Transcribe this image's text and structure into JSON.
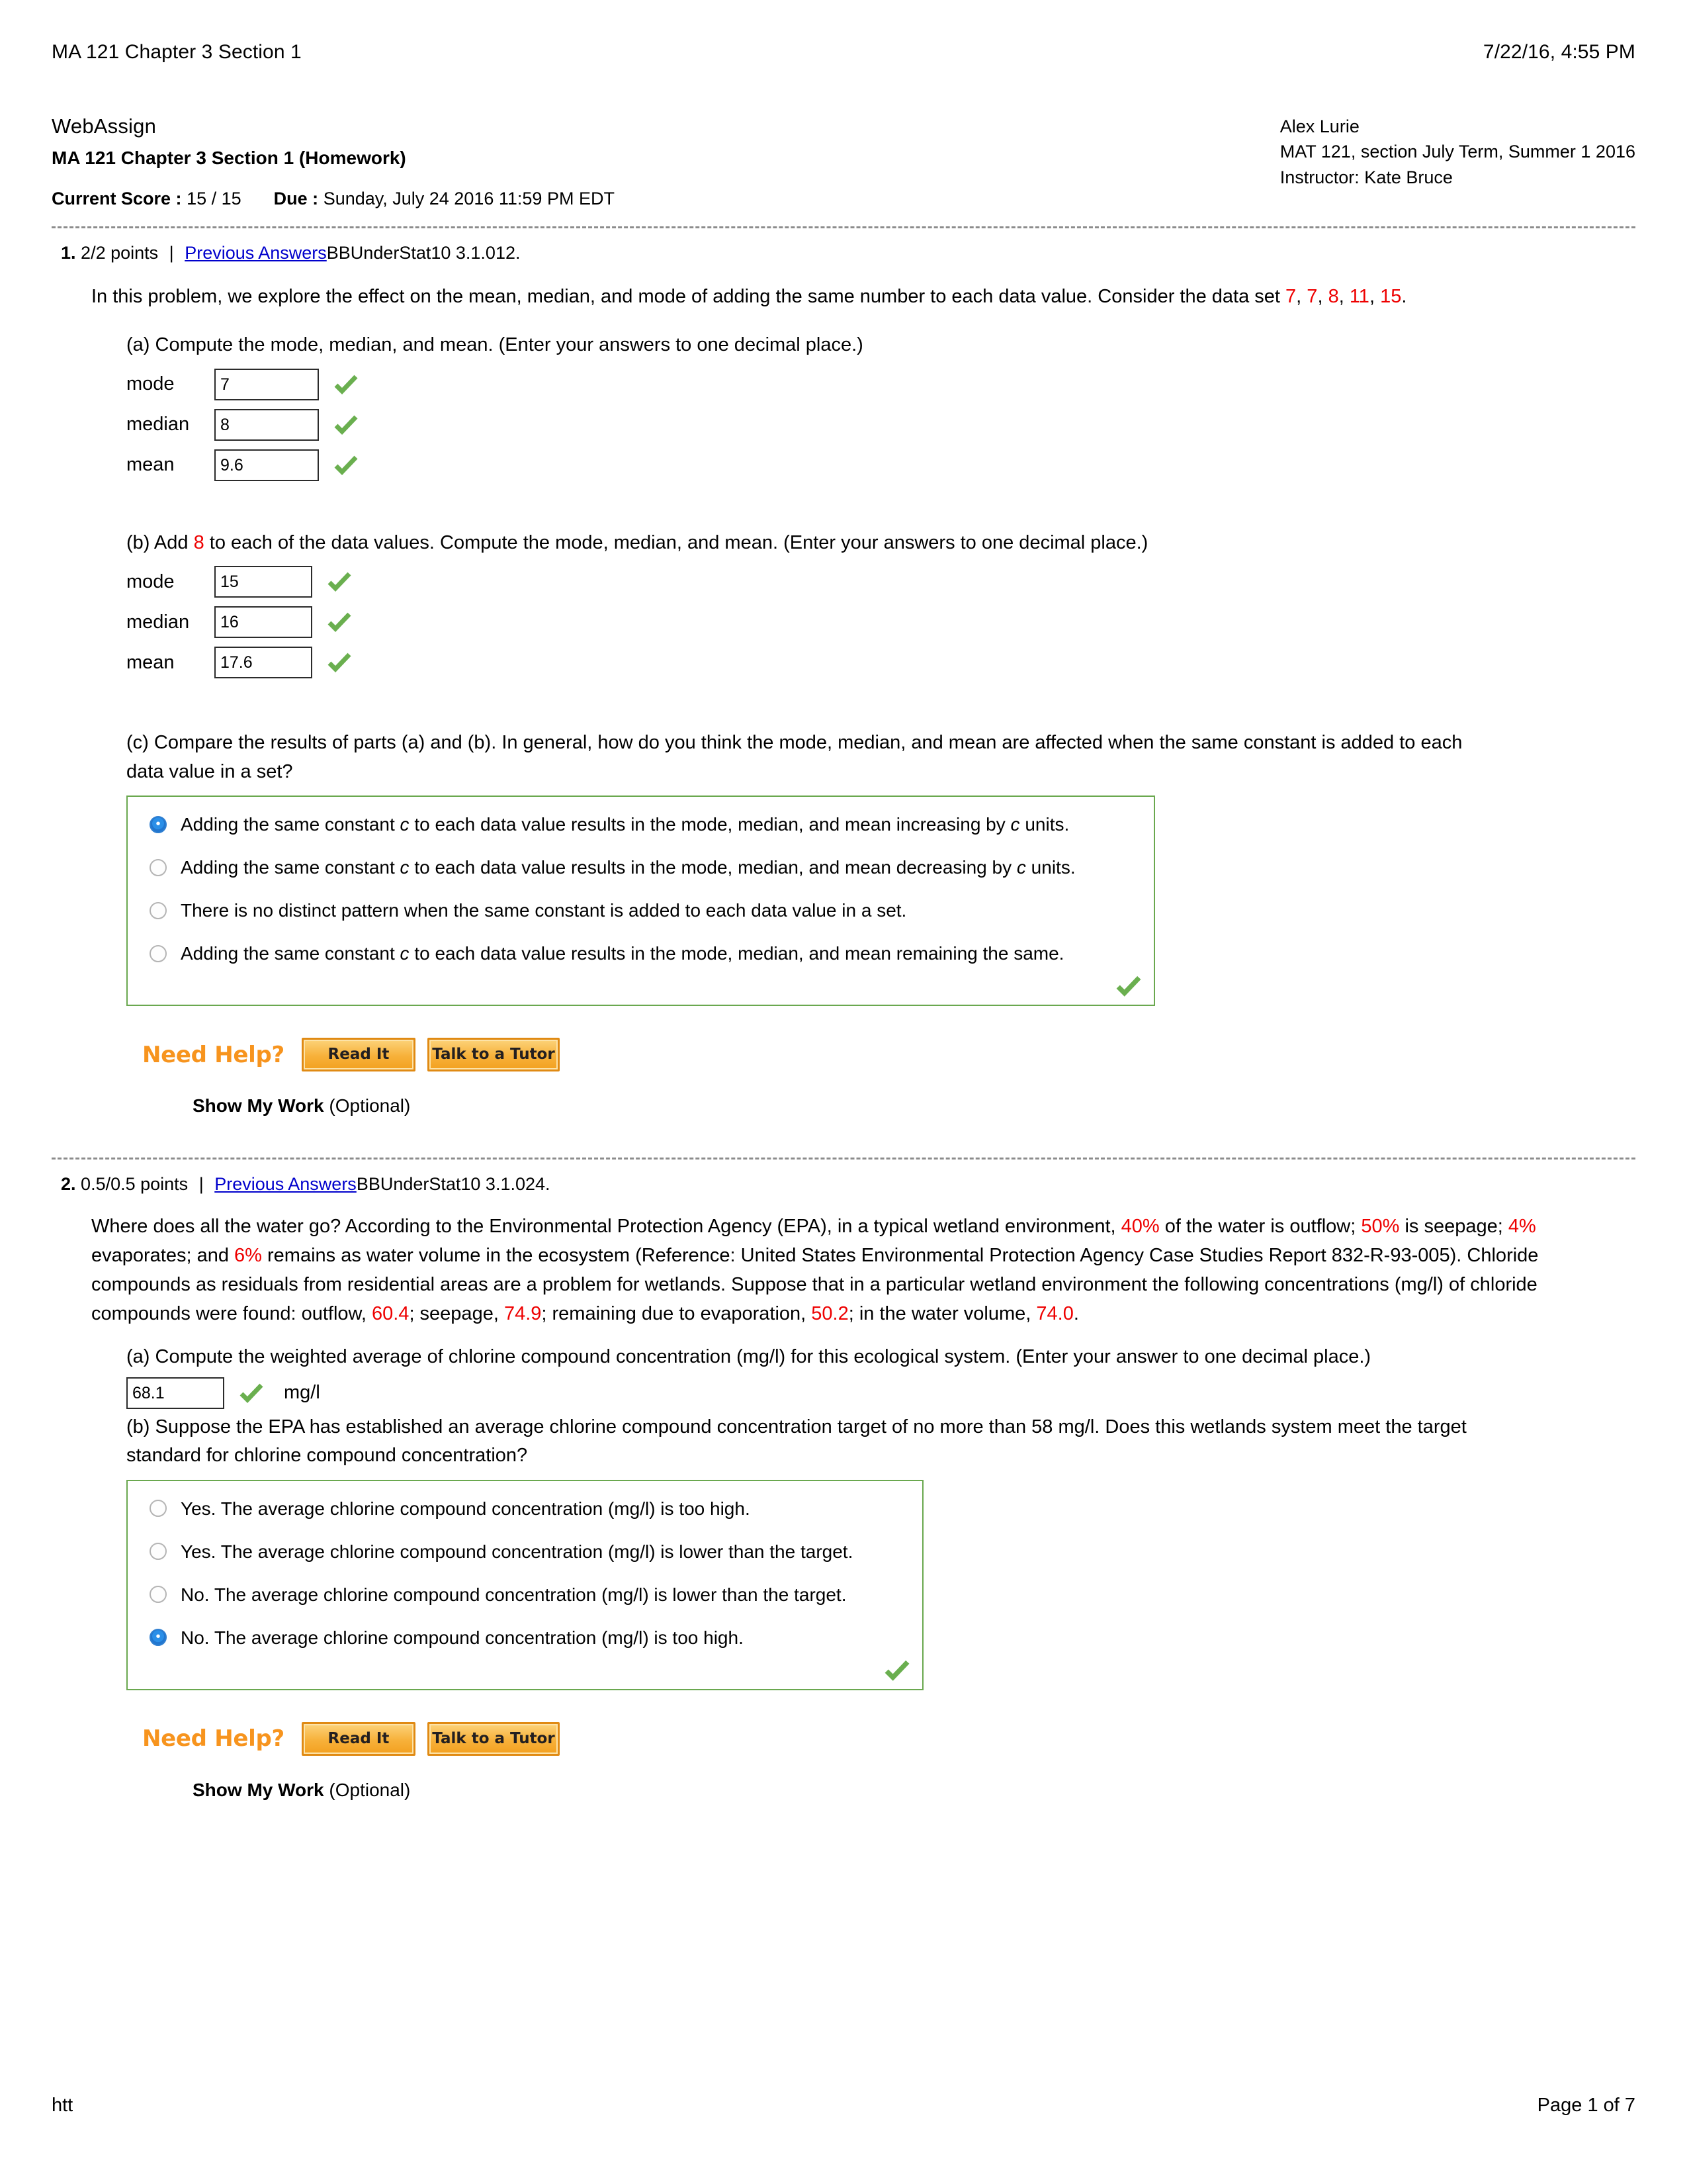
{
  "print_header": {
    "left": "MA 121 Chapter 3 Section 1",
    "right": "7/22/16, 4:55 PM"
  },
  "assignment": {
    "brand": "WebAssign",
    "title": "MA 121 Chapter 3 Section 1 (Homework)",
    "score_label": "Current Score :",
    "score_value": "15 / 15",
    "due_label": "Due :",
    "due_value": "Sunday, July 24 2016 11:59 PM EDT",
    "student": "Alex Lurie",
    "section": "MAT 121, section July Term, Summer 1 2016",
    "instructor": "Instructor: Kate Bruce"
  },
  "questions": [
    {
      "number": "1.",
      "points": "2/2 points",
      "separator": "|",
      "previous_answers": "Previous Answers",
      "code": "BBUnderStat10 3.1.012.",
      "stem_pre": "In this problem, we explore the effect on the mean, median, and mode of adding the same number to each data value. Consider the data set ",
      "data_set": [
        "7",
        "7",
        "8",
        "11",
        "15"
      ],
      "stem_post": ".",
      "part_a": {
        "text": "(a) Compute the mode, median, and mean. (Enter your answers to one decimal place.)",
        "rows": [
          {
            "label": "mode",
            "value": "7",
            "status": "correct"
          },
          {
            "label": "median",
            "value": "8",
            "status": "correct"
          },
          {
            "label": "mean",
            "value": "9.6",
            "status": "correct"
          }
        ]
      },
      "part_b": {
        "text_pre": "(b) Add ",
        "addend": "8",
        "text_post": " to each of the data values. Compute the mode, median, and mean. (Enter your answers to one decimal place.)",
        "rows": [
          {
            "label": "mode",
            "value": "15",
            "status": "correct"
          },
          {
            "label": "median",
            "value": "16",
            "status": "correct"
          },
          {
            "label": "mean",
            "value": "17.6",
            "status": "correct"
          }
        ]
      },
      "part_c": {
        "text_line1": "(c) Compare the results of parts (a) and (b). In general, how do you think the mode, median, and mean are affected when the same constant is added to each",
        "text_line2": "data value in a set?",
        "options": [
          {
            "pre": "Adding the same constant ",
            "var1": "c",
            "mid": " to each data value results in the mode, median, and mean increasing by ",
            "var2": "c",
            "post": " units.",
            "selected": true
          },
          {
            "pre": "Adding the same constant ",
            "var1": "c",
            "mid": " to each data value results in the mode, median, and mean decreasing by ",
            "var2": "c",
            "post": " units.",
            "selected": false
          },
          {
            "pre": "There is no distinct pattern when the same constant is added to each data value in a set.",
            "var1": "",
            "mid": "",
            "var2": "",
            "post": "",
            "selected": false
          },
          {
            "pre": "Adding the same constant ",
            "var1": "c",
            "mid": " to each data value results in the mode, median, and mean remaining the same.",
            "var2": "",
            "post": "",
            "selected": false
          }
        ],
        "status": "correct"
      },
      "need_help_label": "Need Help?",
      "read_it": "Read It",
      "talk_to_tutor": "Talk to a Tutor",
      "show_work_bold": "Show My Work",
      "show_work_optional": " (Optional)"
    },
    {
      "number": "2.",
      "points": "0.5/0.5 points",
      "separator": "|",
      "previous_answers": "Previous Answers",
      "code": "BBUnderStat10 3.1.024.",
      "stem_line1_a": "Where does all the water go? According to the Environmental Protection Agency (EPA), in a typical wetland environment, ",
      "stem_pct_outflow": "40%",
      "stem_line1_b": " of the water is outflow; ",
      "stem_pct_seepage": "50%",
      "stem_line1_c": " is seepage;",
      "stem_pct_evap": "4%",
      "stem_line2_a": " evaporates; and ",
      "stem_pct_remain": "6%",
      "stem_line2_b": " remains as water volume in the ecosystem (Reference: United States Environmental Protection Agency Case Studies Report 832-R-93-005).",
      "stem_line3": "Chloride compounds as residuals from residential areas are a problem for wetlands. Suppose that in a particular wetland environment the following concentrations (mg/l)",
      "stem_line4_a": "of chloride compounds were found: outflow, ",
      "conc_outflow": "60.4",
      "stem_line4_b": "; seepage, ",
      "conc_seepage": "74.9",
      "stem_line4_c": "; remaining due to evaporation, ",
      "conc_evap": "50.2",
      "stem_line4_d": "; in the water volume, ",
      "conc_volume": "74.0",
      "stem_line4_e": ".",
      "part_a": {
        "text": "(a) Compute the weighted average of chlorine compound concentration (mg/l) for this ecological system. (Enter your answer to one decimal place.)",
        "value": "68.1",
        "status": "correct",
        "unit": "mg/l"
      },
      "part_b": {
        "text_line1": "(b) Suppose the EPA has established an average chlorine compound concentration target of no more than 58 mg/l. Does this wetlands system meet the target",
        "text_line2": "standard for chlorine compound concentration?",
        "options": [
          {
            "label": "Yes. The average chlorine compound concentration (mg/l) is too high.",
            "selected": false
          },
          {
            "label": "Yes. The average chlorine compound concentration (mg/l) is lower than the target.",
            "selected": false
          },
          {
            "label": "No. The average chlorine compound concentration (mg/l) is lower than the target.",
            "selected": false
          },
          {
            "label": "No. The average chlorine compound concentration (mg/l) is too high.",
            "selected": true
          }
        ],
        "status": "correct"
      },
      "need_help_label": "Need Help?",
      "read_it": "Read It",
      "talk_to_tutor": "Talk to a Tutor",
      "show_work_bold": "Show My Work",
      "show_work_optional": " (Optional)"
    }
  ],
  "print_footer": {
    "left": "htt",
    "right": "Page 1 of 7"
  },
  "colors": {
    "link": "#0000cc",
    "highlight": "#ee0000",
    "box_border": "#6aa84f",
    "check": "#5fa84e",
    "help_orange": "#f7941e",
    "radio_selected": "#2b8fe8"
  }
}
